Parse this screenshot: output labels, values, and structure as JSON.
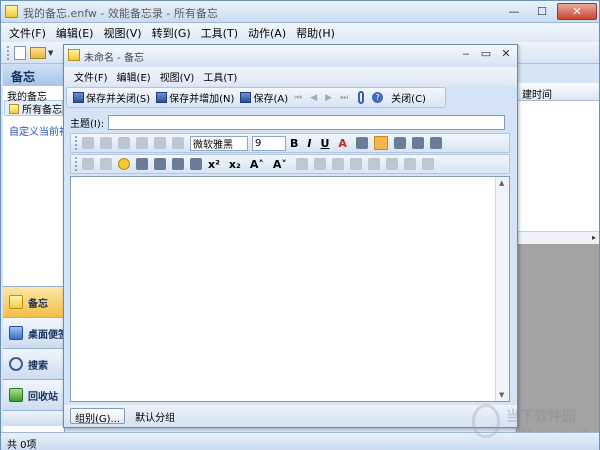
{
  "main": {
    "title": "我的备忘.enfw - 效能备忘录 - 所有备忘",
    "menu": [
      "文件(F)",
      "编辑(E)",
      "视图(V)",
      "转到(G)",
      "工具(T)",
      "动作(A)",
      "帮助(H)"
    ],
    "window_buttons": {
      "minimize": "—",
      "maximize": "☐",
      "close": "✕"
    }
  },
  "left_pane": {
    "header": "备忘",
    "section": "我的备忘",
    "item": "所有备忘",
    "link": "自定义当前视",
    "nav": [
      "备忘",
      "桌面便签",
      "搜索",
      "回收站"
    ]
  },
  "right_pane": {
    "column_header": "建时间",
    "hscroll_arrow": "▸"
  },
  "status": "共 0项",
  "note": {
    "title": "未命名 - 备忘",
    "window_buttons": {
      "minimize": "‒",
      "maximize": "▭",
      "close": "✕"
    },
    "menu": [
      "文件(F)",
      "编辑(E)",
      "视图(V)",
      "工具(T)"
    ],
    "toolbar": {
      "save_close": "保存并关闭(S)",
      "save_add": "保存并增加(N)",
      "save": "保存(A)",
      "close": "关闭(C)",
      "help": "?"
    },
    "subject_label": "主题(I):",
    "subject_value": "",
    "font_name": "微软雅黑",
    "font_size": "9",
    "bold": "B",
    "italic": "I",
    "underline": "U",
    "text_color": "A",
    "superscript": "x²",
    "subscript": "x₂",
    "grow_font": "A˄",
    "shrink_font": "A˅",
    "group_button": "组别(G)...",
    "group_value": "默认分组"
  },
  "colors": {
    "accent": "#f4be48",
    "link": "#2350b8",
    "titlebar": "#c8dbf2"
  }
}
